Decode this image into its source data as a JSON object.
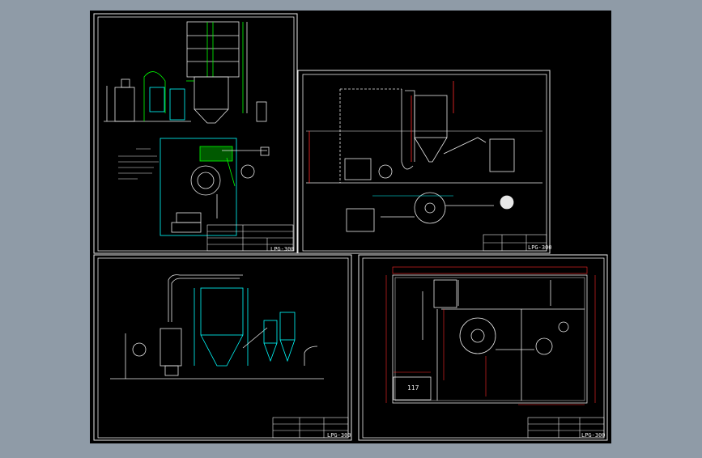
{
  "colors": {
    "chrome": "#8f9ba7",
    "background": "#000000",
    "frame": "#e8e8e8",
    "green": "#00ff00",
    "cyan": "#00ffff",
    "red": "#ff2a2a",
    "white": "#ffffff"
  },
  "sheets": [
    {
      "id": "sheet-1",
      "title_block_code": "LPG-300"
    },
    {
      "id": "sheet-2",
      "title_block_code": "LPG-300"
    },
    {
      "id": "sheet-3",
      "title_block_code": "LPG-300"
    },
    {
      "id": "sheet-4",
      "title_block_code": "LPG-300"
    }
  ],
  "labels": {
    "room_number": "117"
  }
}
